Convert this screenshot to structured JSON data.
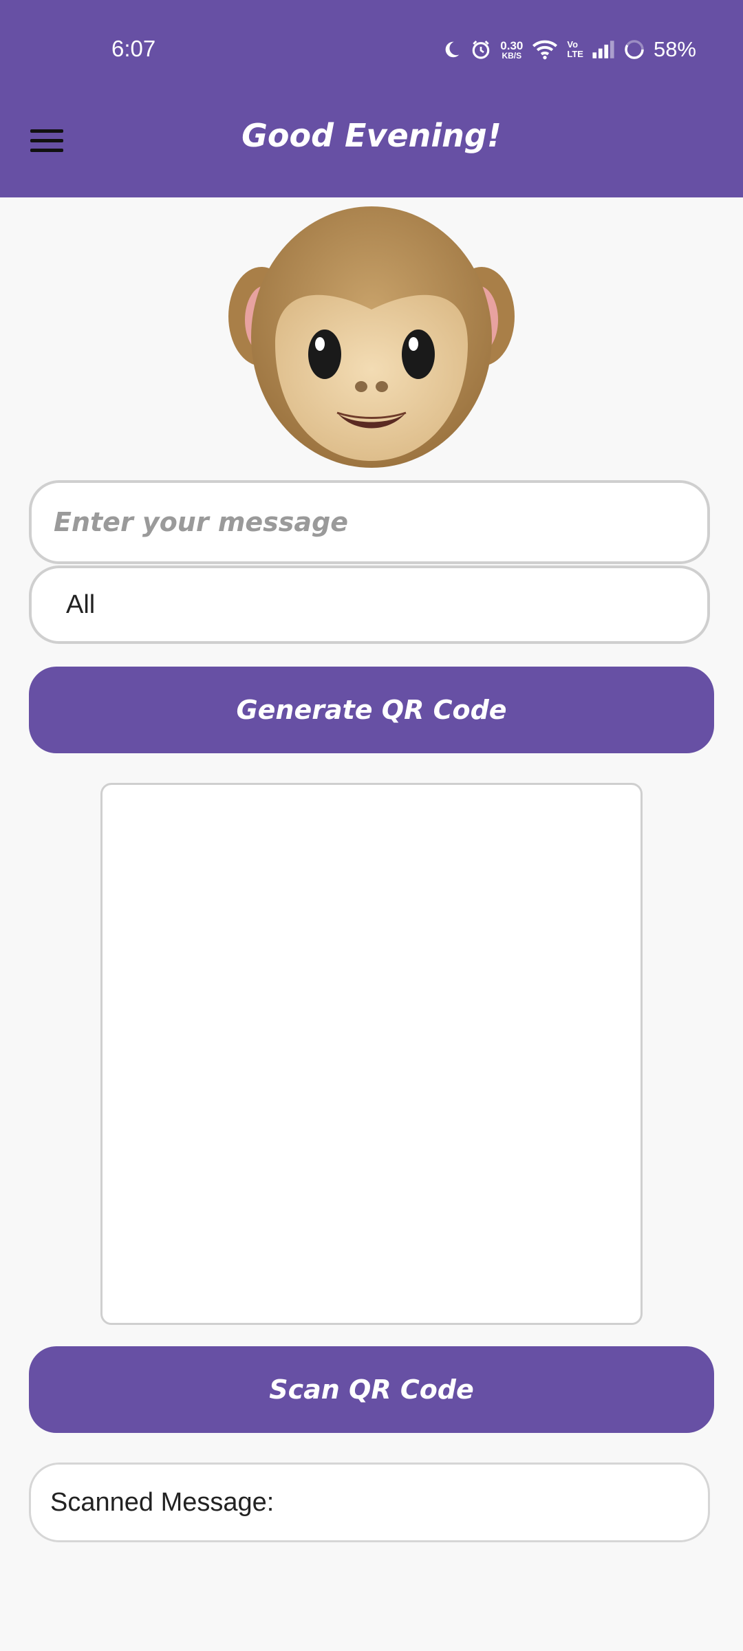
{
  "status_bar": {
    "time": "6:07",
    "net_speed_value": "0.30",
    "net_speed_unit": "KB/S",
    "volte_line1": "Vo",
    "volte_line2": "LTE",
    "battery": "58%"
  },
  "app_bar": {
    "menu_icon": "hamburger-menu-icon",
    "title": "Good Evening!"
  },
  "avatar": {
    "icon": "monkey-face-emoji"
  },
  "message_input": {
    "placeholder": "Enter your message",
    "value": ""
  },
  "recipient_select": {
    "selected": "All"
  },
  "generate_button": {
    "label": "Generate QR Code"
  },
  "scan_button": {
    "label": "Scan QR Code"
  },
  "scanned_message": {
    "label": "Scanned Message:"
  },
  "colors": {
    "accent": "#6750a4",
    "background": "#f8f8f8",
    "border": "#cfcfcf"
  }
}
